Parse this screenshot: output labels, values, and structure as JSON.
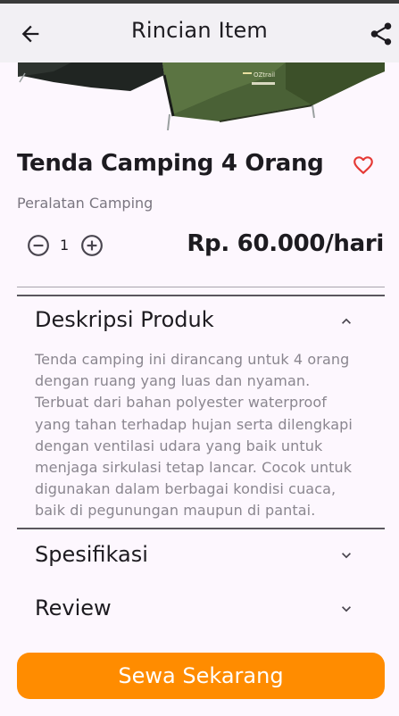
{
  "appbar": {
    "title": "Rincian Item",
    "back_icon": "arrow-left-icon",
    "share_icon": "share-icon"
  },
  "product": {
    "name": "Tenda Camping 4 Orang",
    "category": "Peralatan Camping",
    "quantity": "1",
    "price": "Rp. 60.000/hari",
    "favorite_icon": "heart-outline-icon",
    "image_brand": "OZtrail"
  },
  "sections": {
    "description": {
      "title": "Deskripsi Produk",
      "expanded": true,
      "text": "Tenda camping ini dirancang untuk 4 orang dengan ruang yang luas dan nyaman. Terbuat dari bahan polyester waterproof yang tahan terhadap hujan serta dilengkapi dengan ventilasi udara yang baik untuk menjaga sirkulasi tetap lancar. Cocok untuk digunakan dalam berbagai kondisi cuaca, baik di pegunungan maupun di pantai."
    },
    "specifications": {
      "title": "Spesifikasi",
      "expanded": false
    },
    "review": {
      "title": "Review",
      "expanded": false
    }
  },
  "cta": {
    "label": "Sewa Sekarang"
  },
  "colors": {
    "accent": "#ff8c00",
    "favorite": "#e53935",
    "background": "#fdf7fe",
    "appbar": "#f2f0f4"
  }
}
